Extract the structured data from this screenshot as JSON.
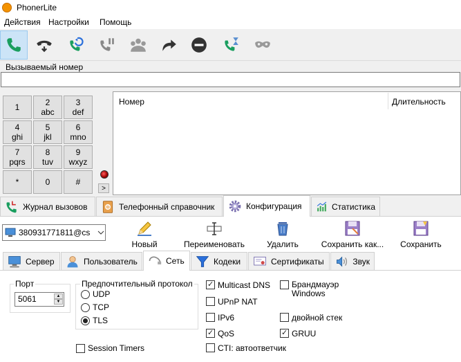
{
  "app": {
    "title": "PhonerLite"
  },
  "menu": [
    "Действия",
    "Настройки",
    "Помощь"
  ],
  "called_number": {
    "label": "Вызываемый номер",
    "value": ""
  },
  "keypad": [
    {
      "digit": "1",
      "letters": ""
    },
    {
      "digit": "2",
      "letters": "abc"
    },
    {
      "digit": "3",
      "letters": "def"
    },
    {
      "digit": "4",
      "letters": "ghi"
    },
    {
      "digit": "5",
      "letters": "jkl"
    },
    {
      "digit": "6",
      "letters": "mno"
    },
    {
      "digit": "7",
      "letters": "pqrs"
    },
    {
      "digit": "8",
      "letters": "tuv"
    },
    {
      "digit": "9",
      "letters": "wxyz"
    },
    {
      "digit": "*",
      "letters": ""
    },
    {
      "digit": "0",
      "letters": ""
    },
    {
      "digit": "#",
      "letters": ""
    }
  ],
  "more_button": ">",
  "call_list": {
    "columns": [
      "Номер",
      "Длительность"
    ],
    "rows": []
  },
  "main_tabs": [
    "Журнал вызовов",
    "Телефонный справочник",
    "Конфигурация",
    "Статистика"
  ],
  "account": {
    "value": "380931771811@cs"
  },
  "actions": [
    "Новый",
    "Переименовать",
    "Удалить",
    "Сохранить как...",
    "Сохранить"
  ],
  "sub_tabs": [
    "Сервер",
    "Пользователь",
    "Сеть",
    "Кодеки",
    "Сертификаты",
    "Звук"
  ],
  "network": {
    "port_label": "Порт",
    "port_value": "5061",
    "protocol_label": "Предпочтительный протокол",
    "protocols": [
      {
        "label": "UDP",
        "selected": false
      },
      {
        "label": "TCP",
        "selected": false
      },
      {
        "label": "TLS",
        "selected": true
      }
    ],
    "session_timers": {
      "label": "Session Timers",
      "checked": false
    },
    "options": [
      {
        "label": "Multicast DNS",
        "checked": true
      },
      {
        "label": "Брандмауэр Windows",
        "checked": false
      },
      {
        "label": "UPnP NAT",
        "checked": false
      },
      {
        "label": "IPv6",
        "checked": false
      },
      {
        "label": "двойной стек",
        "checked": false
      },
      {
        "label": "QoS",
        "checked": true
      },
      {
        "label": "GRUU",
        "checked": true
      },
      {
        "label": "CTI: автоответчик",
        "checked": false
      }
    ]
  },
  "colors": {
    "accent": "#1a9e5f",
    "selection": "#cce4f7"
  }
}
